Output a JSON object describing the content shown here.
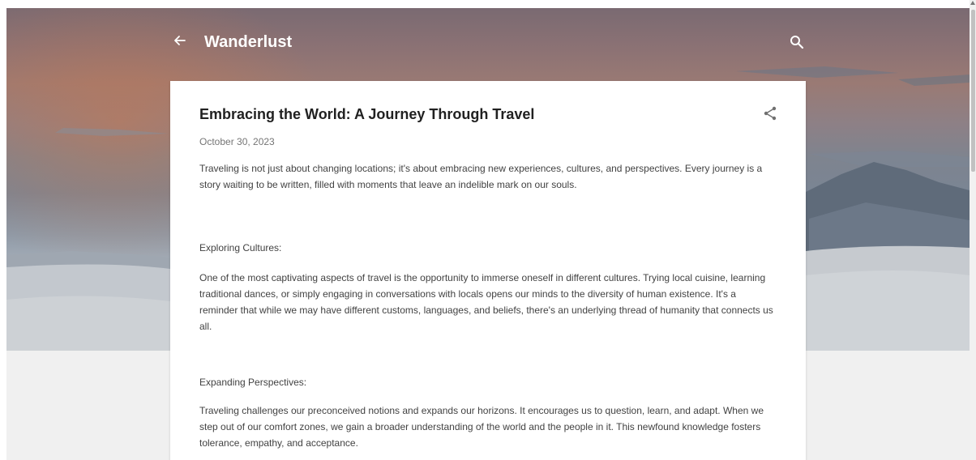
{
  "header": {
    "blog_title": "Wanderlust",
    "back_icon": "arrow-back-icon",
    "search_icon": "search-icon"
  },
  "post": {
    "title": "Embracing the World: A Journey Through Travel",
    "date": "October 30, 2023",
    "share_icon": "share-icon",
    "intro": " Traveling is not just about changing locations; it's about embracing new experiences, cultures, and perspectives. Every journey is a story waiting to be written, filled with moments that leave an indelible mark on our souls.",
    "sections": [
      {
        "heading": "Exploring Cultures:",
        "text": "One of the most captivating aspects of travel is the opportunity to immerse oneself in different cultures. Trying local cuisine, learning traditional dances, or simply engaging in conversations with locals opens our minds to the diversity of human existence. It's a reminder that while we may have different customs, languages, and beliefs, there's an underlying thread of humanity that connects us all."
      },
      {
        "heading": "Expanding Perspectives:",
        "text": "Traveling challenges our preconceived notions and expands our horizons. It encourages us to question, learn, and adapt. When we step out of our comfort zones, we gain a broader understanding of the world and the people in it. This newfound knowledge fosters tolerance, empathy, and acceptance."
      }
    ]
  },
  "colors": {
    "title_text": "#212121",
    "body_text": "#424242",
    "date_text": "#757575",
    "page_background": "#f0f0f0",
    "card_background": "#ffffff"
  }
}
